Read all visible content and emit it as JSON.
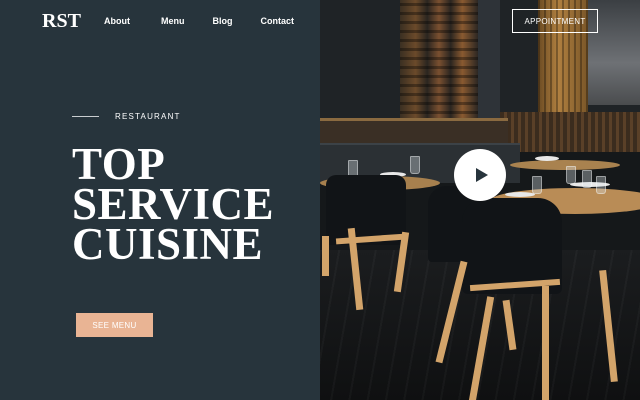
{
  "brand": {
    "logo": "RST"
  },
  "nav": {
    "items": [
      {
        "label": "About"
      },
      {
        "label": "Menu"
      },
      {
        "label": "Blog"
      },
      {
        "label": "Contact"
      }
    ]
  },
  "header": {
    "appointment_label": "APPOINTMENT"
  },
  "hero": {
    "eyebrow": "RESTAURANT",
    "headline_lines": [
      "TOP",
      "SERVICE",
      "CUISINE"
    ],
    "cta_label": "SEE MENU"
  },
  "media": {
    "play_icon": "play-icon"
  },
  "colors": {
    "panel_bg": "#27343c",
    "accent": "#e9b494",
    "text": "#ffffff"
  }
}
